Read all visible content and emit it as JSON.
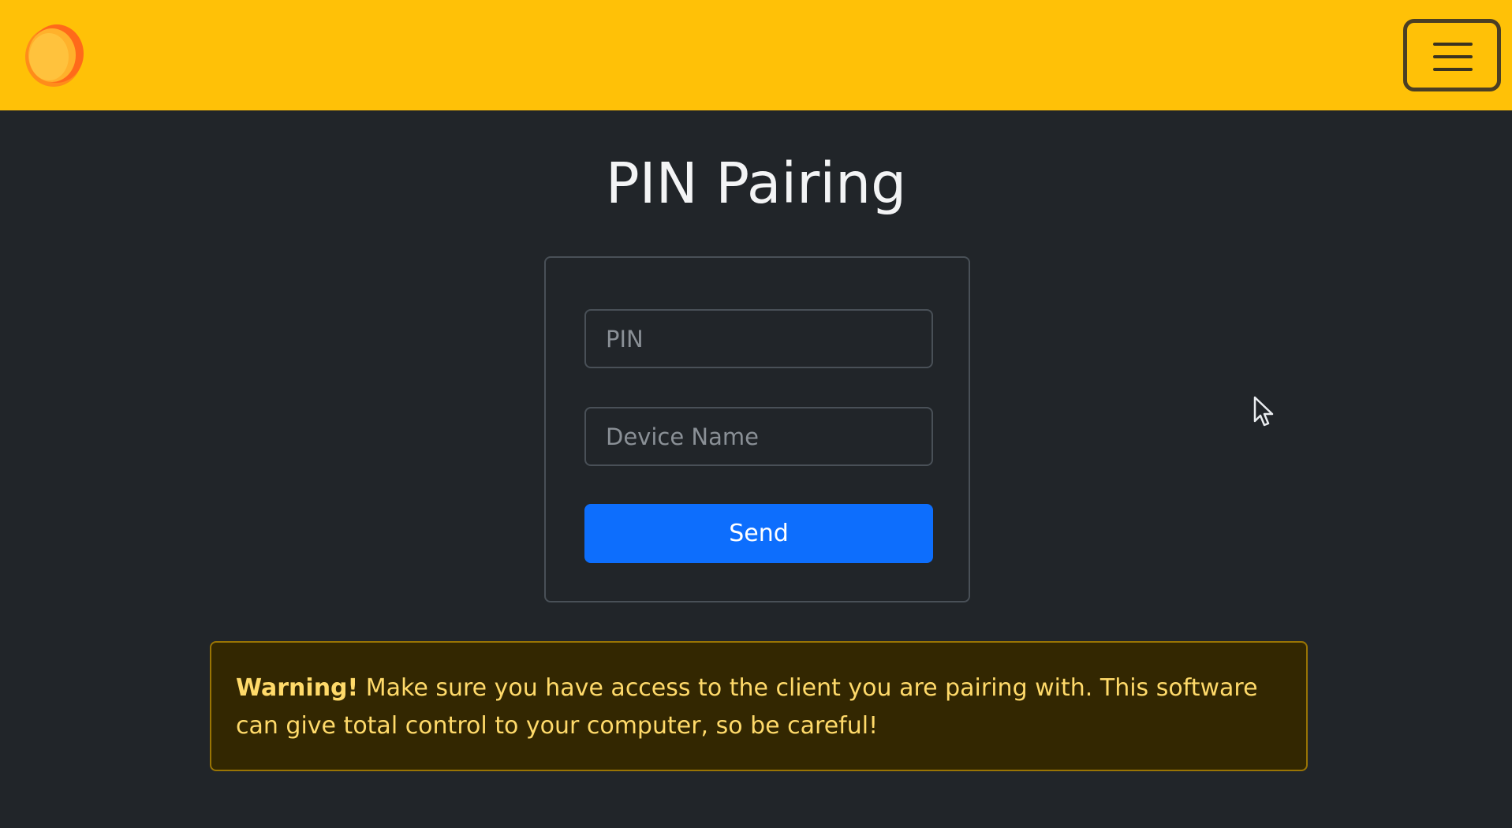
{
  "navbar": {
    "logo_icon": "orange-ring-logo",
    "menu_icon": "hamburger-menu-icon",
    "background_color": "#ffc107"
  },
  "page": {
    "title": "PIN Pairing"
  },
  "form": {
    "pin_placeholder": "PIN",
    "device_name_placeholder": "Device Name",
    "send_label": "Send",
    "send_color": "#0d6efd"
  },
  "alert": {
    "strong": "Warning!",
    "text": " Make sure you have access to the client you are pairing with. This software can give total control to your computer, so be careful!"
  }
}
